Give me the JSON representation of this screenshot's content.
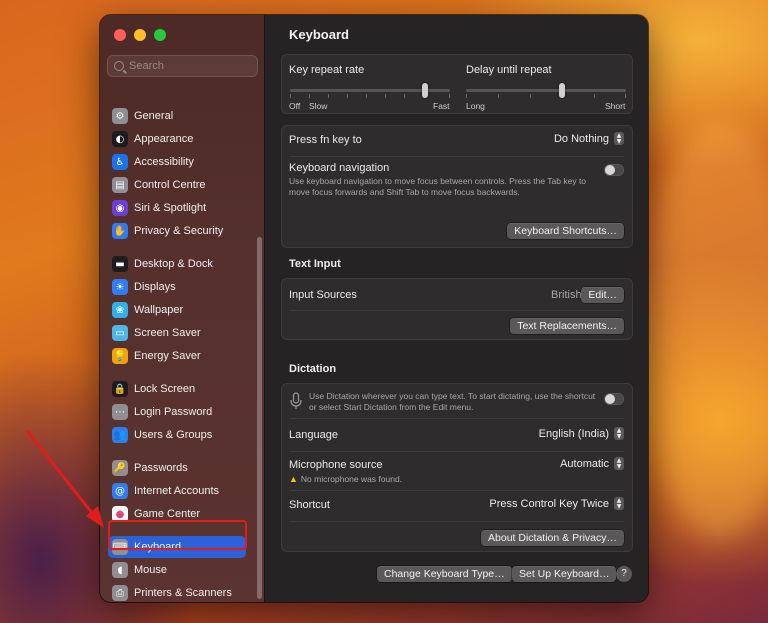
{
  "sidebar": {
    "search_placeholder": "Search",
    "items": [
      {
        "label": "General",
        "icon": "gear-icon",
        "color": "#8e8e93",
        "glyph": "⚙"
      },
      {
        "label": "Appearance",
        "icon": "appearance-icon",
        "color": "#1c1c1e",
        "glyph": "◐"
      },
      {
        "label": "Accessibility",
        "icon": "accessibility-icon",
        "color": "#1a73e8",
        "glyph": "♿"
      },
      {
        "label": "Control Centre",
        "icon": "control-centre-icon",
        "color": "#8e8e93",
        "glyph": "▤"
      },
      {
        "label": "Siri & Spotlight",
        "icon": "siri-icon",
        "color": "#6a3fd1",
        "glyph": "◉"
      },
      {
        "label": "Privacy & Security",
        "icon": "hand-icon",
        "color": "#2f7cf6",
        "glyph": "✋"
      },
      {
        "label": "Desktop & Dock",
        "icon": "dock-icon",
        "color": "#1c1c1e",
        "glyph": "▬"
      },
      {
        "label": "Displays",
        "icon": "sun-icon",
        "color": "#2f7cf6",
        "glyph": "☀"
      },
      {
        "label": "Wallpaper",
        "icon": "flower-icon",
        "color": "#2fb0e8",
        "glyph": "❀"
      },
      {
        "label": "Screen Saver",
        "icon": "screen-saver-icon",
        "color": "#4fb6e8",
        "glyph": "▭"
      },
      {
        "label": "Energy Saver",
        "icon": "bulb-icon",
        "color": "#f0a30a",
        "glyph": "💡"
      },
      {
        "label": "Lock Screen",
        "icon": "lock-icon",
        "color": "#1c1c1e",
        "glyph": "🔒"
      },
      {
        "label": "Login Password",
        "icon": "key-icon",
        "color": "#8e8e93",
        "glyph": "⋯"
      },
      {
        "label": "Users & Groups",
        "icon": "users-icon",
        "color": "#2f7cf6",
        "glyph": "👥"
      },
      {
        "label": "Passwords",
        "icon": "passwords-icon",
        "color": "#8e8e93",
        "glyph": "🔑"
      },
      {
        "label": "Internet Accounts",
        "icon": "at-icon",
        "color": "#2f7cf6",
        "glyph": "@"
      },
      {
        "label": "Game Center",
        "icon": "game-center-icon",
        "color": "#ffffff",
        "glyph": "●"
      },
      {
        "label": "Keyboard",
        "icon": "keyboard-icon",
        "color": "#8e8e93",
        "glyph": "⌨"
      },
      {
        "label": "Mouse",
        "icon": "mouse-icon",
        "color": "#8e8e93",
        "glyph": "◖"
      },
      {
        "label": "Printers & Scanners",
        "icon": "printer-icon",
        "color": "#8e8e93",
        "glyph": "⎙"
      }
    ]
  },
  "page_title": "Keyboard",
  "repeat": {
    "key_repeat_label": "Key repeat rate",
    "key_repeat_min_labels": [
      "Off",
      "Slow"
    ],
    "key_repeat_max_label": "Fast",
    "delay_label": "Delay until repeat",
    "delay_min_label": "Long",
    "delay_max_label": "Short"
  },
  "fn": {
    "label": "Press fn key to",
    "value": "Do Nothing"
  },
  "nav": {
    "label": "Keyboard navigation",
    "description": "Use keyboard navigation to move focus between controls. Press the Tab key to move focus forwards and Shift Tab to move focus backwards.",
    "shortcuts_button": "Keyboard Shortcuts…"
  },
  "text_input": {
    "title": "Text Input",
    "sources_label": "Input Sources",
    "sources_value": "British",
    "edit_button": "Edit…",
    "replacements_button": "Text Replacements…"
  },
  "dictation": {
    "title": "Dictation",
    "description": "Use Dictation wherever you can type text. To start dictating, use the shortcut or select Start Dictation from the Edit menu.",
    "language_label": "Language",
    "language_value": "English (India)",
    "mic_label": "Microphone source",
    "mic_value": "Automatic",
    "mic_warning": "No microphone was found.",
    "shortcut_label": "Shortcut",
    "shortcut_value": "Press Control Key Twice",
    "about_button": "About Dictation & Privacy…"
  },
  "footer": {
    "change_type_button": "Change Keyboard Type…",
    "setup_button": "Set Up Keyboard…",
    "help_label": "?"
  },
  "colors": {
    "selection": "#2c62d8",
    "annotation_red": "#e21b1b"
  }
}
